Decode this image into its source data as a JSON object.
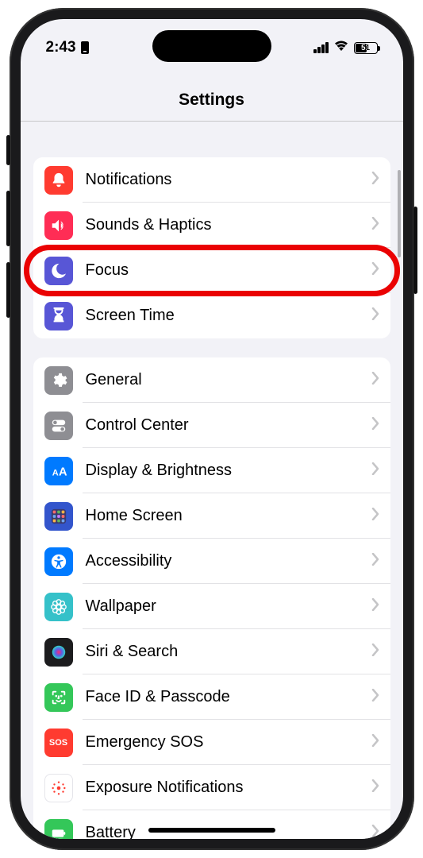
{
  "status": {
    "time": "2:43",
    "battery": "51"
  },
  "header": {
    "title": "Settings"
  },
  "groups": [
    {
      "rows": [
        {
          "label": "Notifications",
          "icon": "bell-icon",
          "bg": "#ff3b30"
        },
        {
          "label": "Sounds & Haptics",
          "icon": "speaker-icon",
          "bg": "#ff2d55"
        },
        {
          "label": "Focus",
          "icon": "moon-icon",
          "bg": "#5856d6",
          "highlighted": true
        },
        {
          "label": "Screen Time",
          "icon": "hourglass-icon",
          "bg": "#5856d6"
        }
      ]
    },
    {
      "rows": [
        {
          "label": "General",
          "icon": "gear-icon",
          "bg": "#8e8e93"
        },
        {
          "label": "Control Center",
          "icon": "switches-icon",
          "bg": "#8e8e93"
        },
        {
          "label": "Display & Brightness",
          "icon": "aa-icon",
          "bg": "#007aff"
        },
        {
          "label": "Home Screen",
          "icon": "grid-icon",
          "bg": "#3355cc"
        },
        {
          "label": "Accessibility",
          "icon": "accessibility-icon",
          "bg": "#007aff"
        },
        {
          "label": "Wallpaper",
          "icon": "flower-icon",
          "bg": "#35c1c9"
        },
        {
          "label": "Siri & Search",
          "icon": "siri-icon",
          "bg": "#1c1c1e"
        },
        {
          "label": "Face ID & Passcode",
          "icon": "faceid-icon",
          "bg": "#34c759"
        },
        {
          "label": "Emergency SOS",
          "icon": "sos-icon",
          "bg": "#ff3b30",
          "textIcon": "SOS"
        },
        {
          "label": "Exposure Notifications",
          "icon": "exposure-icon",
          "bg": "#ffffff"
        },
        {
          "label": "Battery",
          "icon": "battery-icon",
          "bg": "#34c759"
        }
      ]
    }
  ]
}
